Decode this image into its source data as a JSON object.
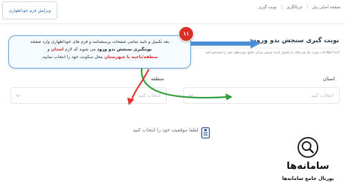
{
  "header": {
    "edit_button": "ویرایش فرم خوداظهاری",
    "breadcrumb": [
      "صفحه اصلی پنل",
      "غربالگری",
      "نوبت گیری"
    ]
  },
  "page": {
    "title": "نوبت گیری سنجش بدو ورود",
    "description": "ابتدا اطلاعات مورد نیاز هر فیلد را تکمیل کرده سپس مرکز جامع موردنظر خود را جستجو کنید"
  },
  "form": {
    "province_label": "استان",
    "province_placeholder": "انتخاب کنید",
    "region_label": "منطقه",
    "region_placeholder": "انتخاب کنید",
    "location_hint": "لطفا موقعیت خود را انتخاب کنید"
  },
  "annotation": {
    "step_number": "۱۱",
    "line1": "بعد تکمیل و تایید تمامی صفحات پرسشنامه و فرم های خوداظهاری وارد صفحه",
    "line2_bold": "نوبتگیری سنجش بدو ورود",
    "line2_rest": " می شوید که لازم ",
    "line2_red": "استان",
    "line2_end": " و",
    "line3_red": "منطقه/ناحیه یا شهرستان",
    "line3_rest": " محل سکونت خود را انتخاب نمایید."
  },
  "logo": {
    "name": "سامانه‌ها",
    "subtitle": "پورتال جامع سامانه‌ها"
  },
  "colors": {
    "accent_blue": "#1f5fb6",
    "annotation_border": "#5da3dc",
    "badge_red": "#d93025",
    "arrow_green": "#2e9e3a",
    "arrow_red": "#e0362c"
  }
}
